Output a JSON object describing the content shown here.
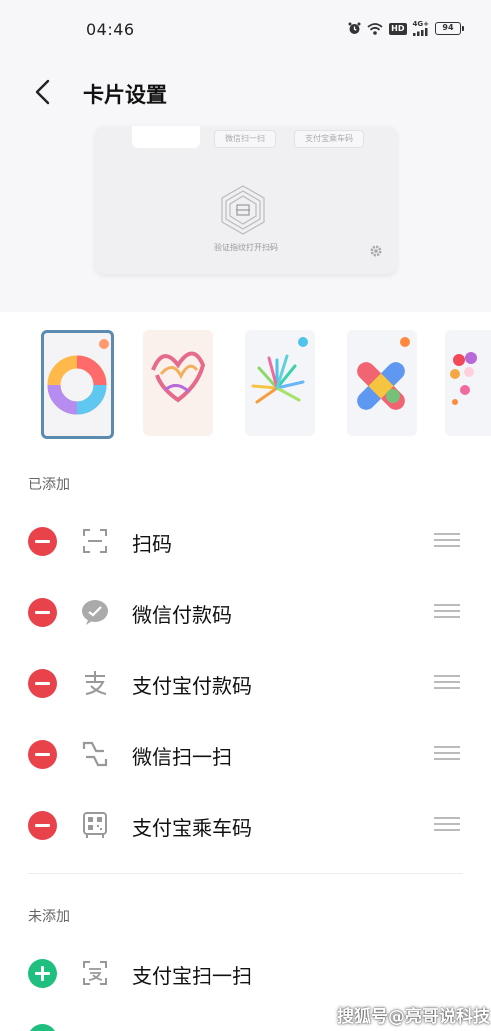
{
  "status_bar": {
    "time": "04:46",
    "hd": "HD",
    "network": "4G+",
    "battery": "94"
  },
  "header": {
    "title": "卡片设置",
    "back_icon": "chevron-left-icon"
  },
  "preview": {
    "chip_1": "微信扫一扫",
    "chip_2": "支付宝乘车码",
    "hint": "验证指纹打开扫码",
    "gear_icon": "gear-icon"
  },
  "themes": [
    {
      "name": "ring",
      "selected": true
    },
    {
      "name": "heart-ribbon",
      "selected": false
    },
    {
      "name": "burst",
      "selected": false
    },
    {
      "name": "cross",
      "selected": false
    },
    {
      "name": "dots",
      "selected": false
    }
  ],
  "added": {
    "label": "已添加",
    "items": [
      {
        "label": "扫码",
        "icon": "scan-frame-icon"
      },
      {
        "label": "微信付款码",
        "icon": "wechat-icon"
      },
      {
        "label": "支付宝付款码",
        "icon": "alipay-icon"
      },
      {
        "label": "微信扫一扫",
        "icon": "wechat-scan-icon"
      },
      {
        "label": "支付宝乘车码",
        "icon": "qr-bus-icon"
      }
    ]
  },
  "not_added": {
    "label": "未添加",
    "items": [
      {
        "label": "支付宝扫一扫",
        "icon": "alipay-scan-icon"
      }
    ]
  },
  "colors": {
    "remove": "#e8424b",
    "add": "#1fbf7f",
    "selected_border": "#5b8bb0"
  },
  "watermark": "搜狐号@亮哥说科技"
}
